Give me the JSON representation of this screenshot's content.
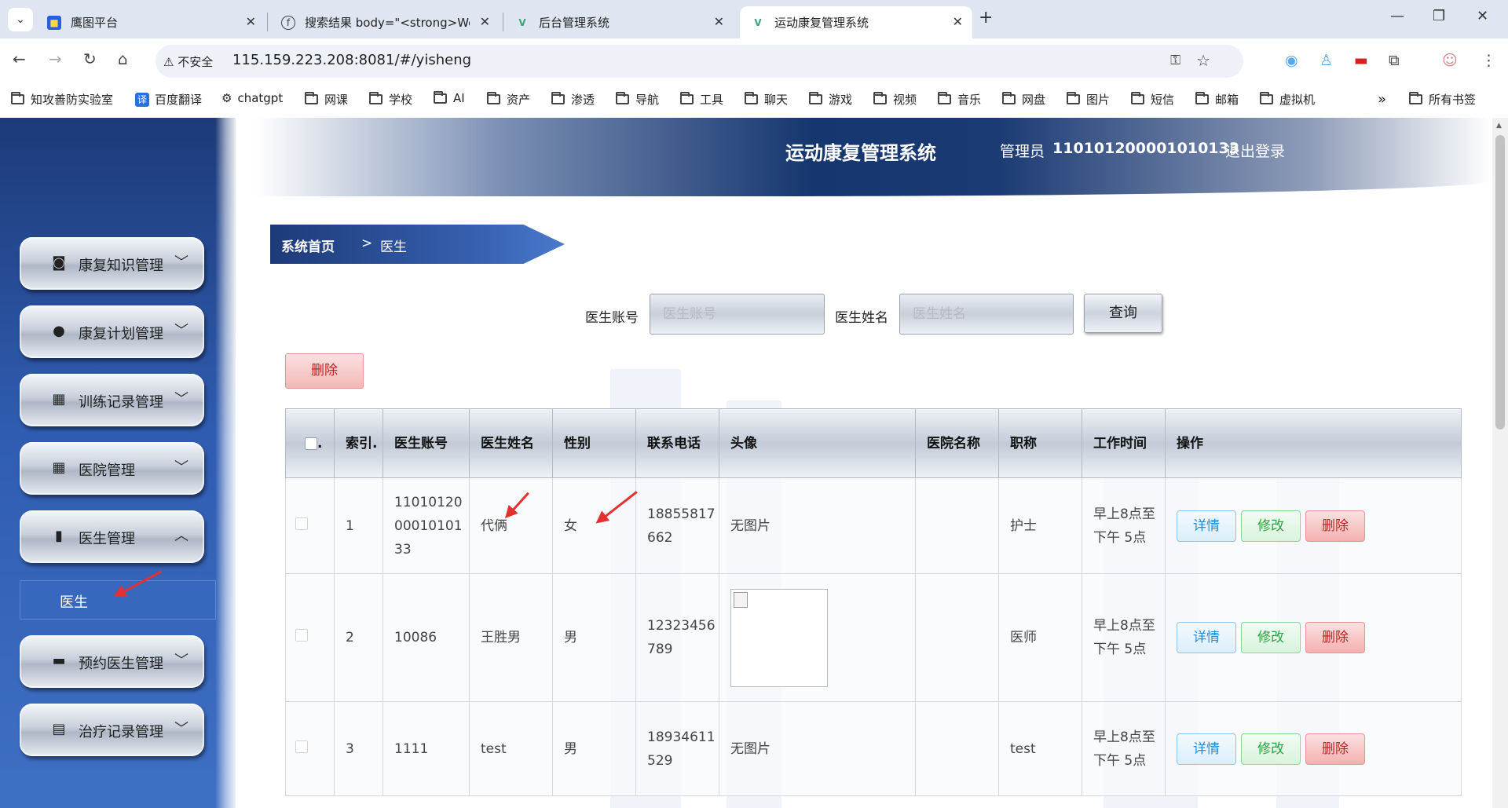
{
  "browser": {
    "tabs": [
      {
        "label": "鹰图平台",
        "favicon": "hunter-favicon"
      },
      {
        "label": "搜索结果 body=\"<strong>We",
        "favicon": "fofa-favicon"
      },
      {
        "label": "后台管理系统",
        "favicon": "vue-favicon"
      },
      {
        "label": "运动康复管理系统",
        "favicon": "vue-favicon"
      }
    ],
    "active_tab": 3,
    "security_label": "不安全",
    "url": "115.159.223.208:8081/#/yisheng",
    "bookmarks": [
      "知攻善防实验室",
      "百度翻译",
      "chatgpt",
      "网课",
      "学校",
      "AI",
      "资产",
      "渗透",
      "导航",
      "工具",
      "聊天",
      "游戏",
      "视频",
      "音乐",
      "网盘",
      "图片",
      "短信",
      "邮箱",
      "虚拟机"
    ],
    "bookmark_icons": {
      "百度翻译": "译"
    },
    "all_bookmarks": "所有书签",
    "more_glyph": "»"
  },
  "header": {
    "title": "运动康复管理系统",
    "role": "管理员",
    "user_id": "110101200001010133",
    "logout": "退出登录"
  },
  "sidebar": {
    "items": [
      {
        "label": "康复知识管理",
        "icon": "wallet-icon",
        "glyph": "◙",
        "chevron": "﹀"
      },
      {
        "label": "康复计划管理",
        "icon": "user-icon",
        "glyph": "●",
        "chevron": "﹀"
      },
      {
        "label": "训练记录管理",
        "icon": "grid-icon",
        "glyph": "▦",
        "chevron": "﹀"
      },
      {
        "label": "医院管理",
        "icon": "grid-icon",
        "glyph": "▦",
        "chevron": "﹀"
      },
      {
        "label": "医生管理",
        "icon": "bar-chart-icon",
        "glyph": "▮",
        "chevron": "︿"
      },
      {
        "label": "预约医生管理",
        "icon": "ticket-icon",
        "glyph": "▬",
        "chevron": "﹀"
      },
      {
        "label": "治疗记录管理",
        "icon": "clipboard-icon",
        "glyph": "▤",
        "chevron": "﹀"
      }
    ],
    "submenu": {
      "label": "医生"
    }
  },
  "breadcrumb": {
    "home": "系统首页",
    "separator": ">",
    "current": "医生"
  },
  "search": {
    "account_label": "医生账号",
    "account_placeholder": "医生账号",
    "name_label": "医生姓名",
    "name_placeholder": "医生姓名",
    "query_button": "查询"
  },
  "batch_delete": "删除",
  "table": {
    "columns": [
      ".",
      "索引.",
      "医生账号",
      "医生姓名",
      "性别",
      "联系电话",
      "头像",
      "医院名称",
      "职称",
      "工作时间",
      "操作"
    ],
    "rows": [
      {
        "index": "1",
        "account": "110101200001010133",
        "name": "代俩",
        "gender": "女",
        "phone": "18855817662",
        "avatar": "无图片",
        "hospital": "",
        "title": "护士",
        "hours": "早上8点至下午 5点"
      },
      {
        "index": "2",
        "account": "10086",
        "name": "王胜男",
        "gender": "男",
        "phone": "12323456789",
        "avatar": "",
        "hospital": "",
        "title": "医师",
        "hours": "早上8点至下午 5点"
      },
      {
        "index": "3",
        "account": "1111",
        "name": "test",
        "gender": "男",
        "phone": "18934611529",
        "avatar": "无图片",
        "hospital": "",
        "title": "test",
        "hours": "早上8点至下午 5点"
      }
    ],
    "actions": {
      "detail": "详情",
      "edit": "修改",
      "delete": "删除"
    }
  },
  "colors": {
    "sidebar_blue": "#2f5cb0",
    "annotation_red": "#e53030",
    "delete_red": "#c02222",
    "detail_blue": "#2b8ad0",
    "edit_green": "#2da145"
  }
}
